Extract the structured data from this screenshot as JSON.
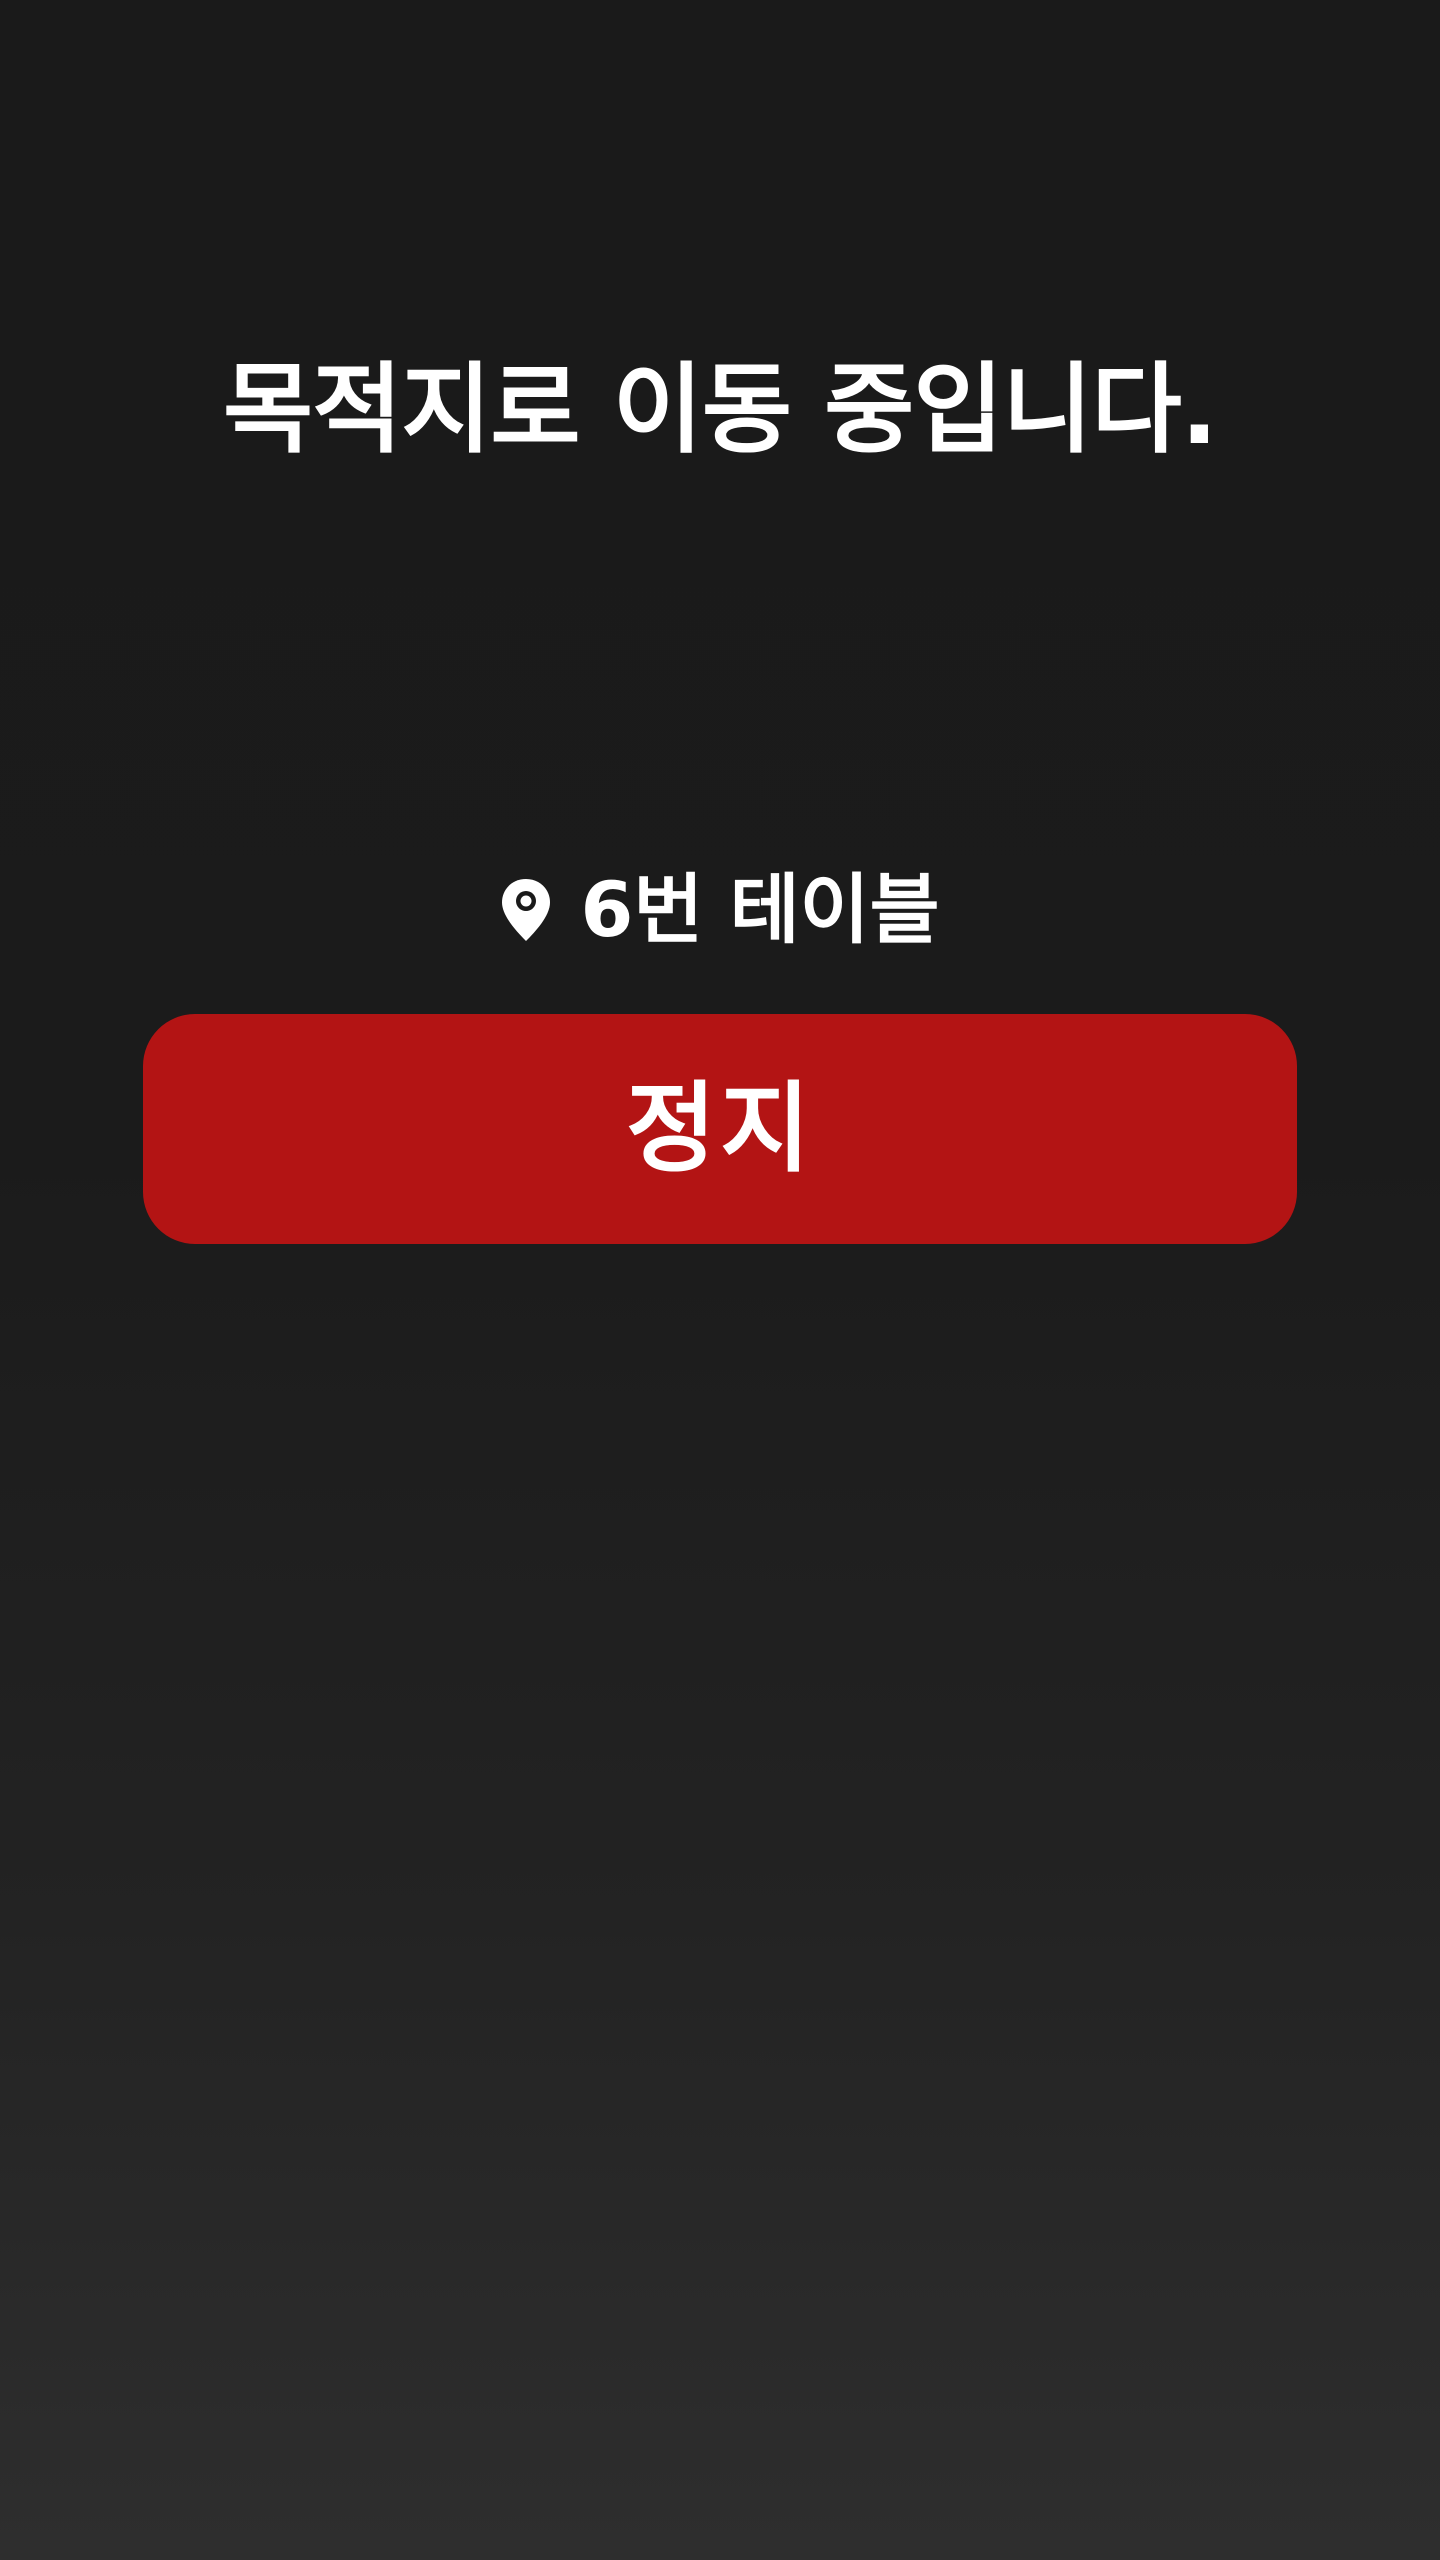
{
  "status": {
    "title": "목적지로 이동 중입니다."
  },
  "destination": {
    "icon": "location-pin-icon",
    "label": "6번 테이블"
  },
  "stop_button": {
    "label": "정지",
    "color": "#b31414"
  },
  "colors": {
    "background_top": "#1a1a1a",
    "background_bottom": "#2e2e2e",
    "text": "#ffffff"
  }
}
